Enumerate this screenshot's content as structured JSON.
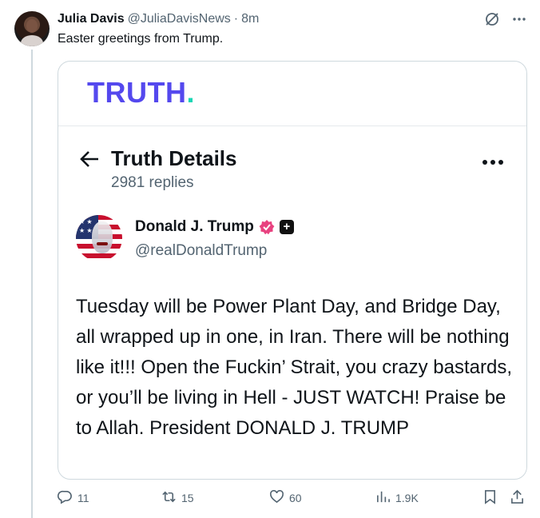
{
  "tweet": {
    "author_name": "Julia Davis",
    "author_handle": "@JuliaDavisNews",
    "separator": "·",
    "time": "8m",
    "text": "Easter greetings from Trump."
  },
  "card": {
    "logo_text": "TRUTH",
    "logo_dot": ".",
    "title": "Truth Details",
    "replies": "2981 replies",
    "poster_name": "Donald J. Trump",
    "poster_handle": "@realDonaldTrump",
    "body": "Tuesday will be Power Plant Day, and Bridge Day, all wrapped up in one, in Iran. There will be nothing like it!!! Open the Fuckin’ Strait, you crazy bastards, or you’ll be living in Hell - JUST WATCH! Praise be to Allah. President DONALD J. TRUMP"
  },
  "actions": {
    "replies": "11",
    "reposts": "15",
    "likes": "60",
    "views": "1.9K"
  },
  "colors": {
    "truth_logo": "#5448ee",
    "truth_dot": "#17d6b5",
    "verified": "#e8417f",
    "muted": "#536471"
  },
  "icons": [
    "grok-icon",
    "more-icon",
    "back-arrow-icon",
    "verified-badge-icon",
    "reply-icon",
    "repost-icon",
    "like-icon",
    "views-icon",
    "bookmark-icon",
    "share-icon"
  ]
}
